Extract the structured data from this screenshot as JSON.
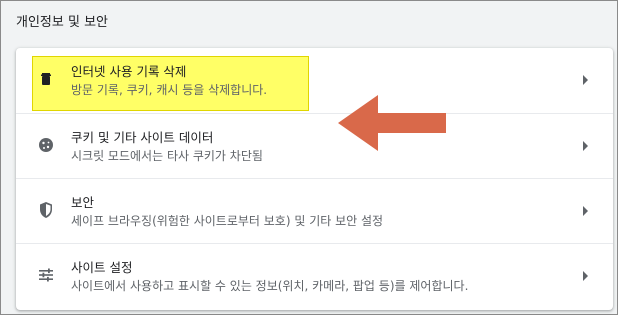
{
  "section": {
    "title": "개인정보 및 보안"
  },
  "rows": [
    {
      "title": "인터넷 사용 기록 삭제",
      "desc": "방문 기록, 쿠키, 캐시 등을 삭제합니다.",
      "icon": "trash-icon",
      "highlighted": true
    },
    {
      "title": "쿠키 및 기타 사이트 데이터",
      "desc": "시크릿 모드에서는 타사 쿠키가 차단됨",
      "icon": "cookie-icon"
    },
    {
      "title": "보안",
      "desc": "세이프 브라우징(위험한 사이트로부터 보호) 및 기타 보안 설정",
      "icon": "shield-icon"
    },
    {
      "title": "사이트 설정",
      "desc": "사이트에서 사용하고 표시할 수 있는 정보(위치, 카메라, 팝업 등)를 제어합니다.",
      "icon": "sliders-icon"
    }
  ],
  "colors": {
    "highlight": "#ffff66",
    "arrow": "#d9694a"
  }
}
